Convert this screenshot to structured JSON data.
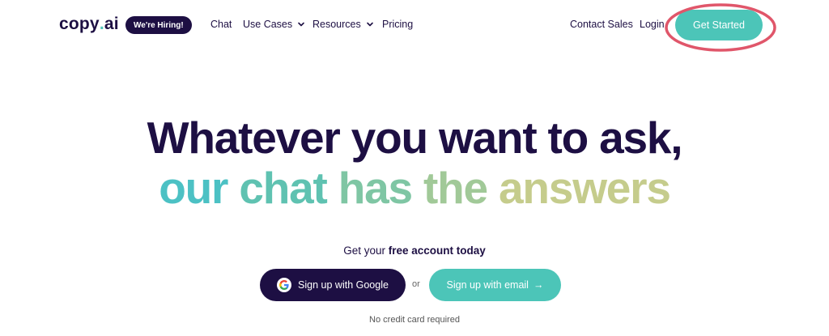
{
  "header": {
    "logo_text": "copy",
    "logo_dot": ".",
    "logo_suffix": "ai",
    "hiring_badge": "We're Hiring!",
    "nav": {
      "chat": "Chat",
      "use_cases": "Use Cases",
      "resources": "Resources",
      "pricing": "Pricing",
      "contact_sales": "Contact Sales",
      "login": "Login"
    },
    "get_started": "Get Started"
  },
  "hero": {
    "headline": "Whatever you want to ask,",
    "subline_words": [
      "our",
      "chat",
      "has",
      "the",
      "answers"
    ],
    "prompt_prefix": "Get your ",
    "prompt_bold": "free account today",
    "google_button": "Sign up with Google",
    "or_text": "or",
    "email_button": "Sign up with email",
    "email_arrow": "→",
    "no_card": "No credit card required"
  },
  "colors": {
    "brand_dark": "#1d0f43",
    "brand_teal": "#4cc5b8",
    "annotation_red": "#e0566a"
  }
}
